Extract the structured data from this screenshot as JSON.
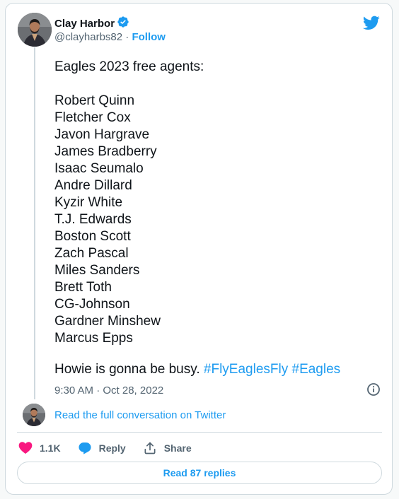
{
  "author": {
    "name": "Clay Harbor",
    "handle": "@clayharbs82",
    "separator": " · ",
    "follow_label": "Follow"
  },
  "tweet": {
    "body": "Eagles 2023 free agents:\n\nRobert Quinn\nFletcher Cox\nJavon Hargrave\nJames Bradberry\nIsaac Seumalo\nAndre Dillard\nKyzir White\nT.J. Edwards\nBoston Scott\nZach Pascal\nMiles Sanders\nBrett Toth\nCG-Johnson\nGardner Minshew\nMarcus Epps",
    "closing_text": "Howie is gonna be busy. ",
    "hashtags": [
      "#FlyEaglesFly",
      "#Eagles"
    ],
    "timestamp": "9:30 AM · Oct 28, 2022"
  },
  "read_conversation_label": "Read the full conversation on Twitter",
  "actions": {
    "likes": "1.1K",
    "reply_label": "Reply",
    "share_label": "Share"
  },
  "read_replies_label": "Read 87 replies",
  "colors": {
    "accent": "#1d9bf0",
    "like": "#f91880",
    "text": "#0f1419",
    "muted": "#536471",
    "border": "#cfd9de"
  },
  "icons": [
    "verified-badge-icon",
    "twitter-bird-icon",
    "info-icon",
    "heart-icon",
    "reply-bubble-icon",
    "share-icon"
  ]
}
